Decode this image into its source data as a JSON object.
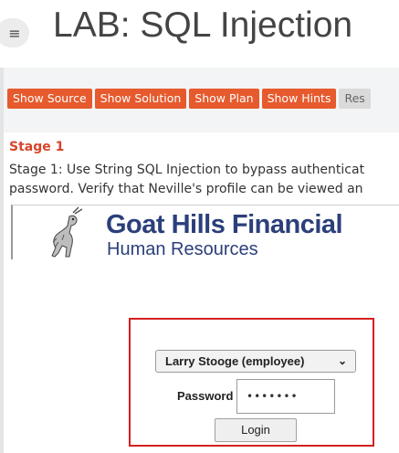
{
  "header": {
    "menu_icon": "hamburger-icon",
    "title": "LAB: SQL Injection"
  },
  "toolbar": {
    "buttons": [
      "Show Source",
      "Show Solution",
      "Show Plan",
      "Show Hints",
      "Res"
    ]
  },
  "stage": {
    "title": "Stage 1",
    "description_line1": "Stage 1: Use String SQL Injection to bypass authenticat",
    "description_line2": "password. Verify that Neville's profile can be viewed an"
  },
  "logo": {
    "icon": "goat-icon",
    "title": "Goat Hills Financial",
    "subtitle": "Human Resources"
  },
  "login": {
    "employee_selected": "Larry Stooge (employee)",
    "password_label": "Password",
    "password_value": "•••••••",
    "login_button": "Login"
  },
  "colors": {
    "accent": "#e65a2d",
    "stage_title": "#d8442a",
    "logo_text": "#2b3f7a",
    "highlight_border": "#d42020"
  }
}
